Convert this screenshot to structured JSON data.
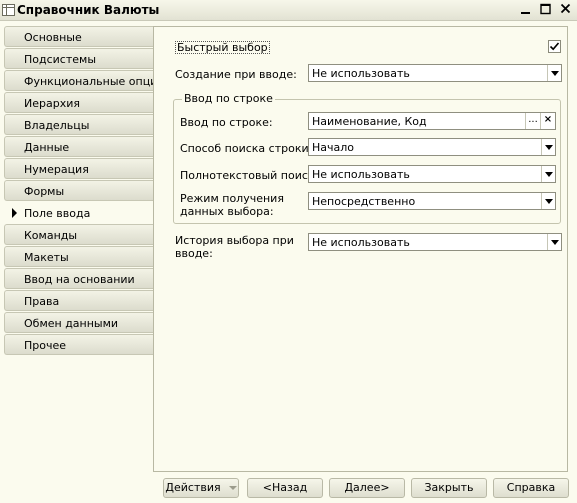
{
  "window": {
    "title": "Справочник Валюты",
    "icon": "table-icon"
  },
  "nav": {
    "items": [
      {
        "label": "Основные"
      },
      {
        "label": "Подсистемы"
      },
      {
        "label": "Функциональные опции"
      },
      {
        "label": "Иерархия"
      },
      {
        "label": "Владельцы"
      },
      {
        "label": "Данные"
      },
      {
        "label": "Нумерация"
      },
      {
        "label": "Формы"
      },
      {
        "label": "Поле ввода"
      },
      {
        "label": "Команды"
      },
      {
        "label": "Макеты"
      },
      {
        "label": "Ввод на основании"
      },
      {
        "label": "Права"
      },
      {
        "label": "Обмен данными"
      },
      {
        "label": "Прочее"
      }
    ],
    "active_index": 8
  },
  "form": {
    "quick_select": {
      "label": "Быстрый выбор",
      "checked": true
    },
    "create_on_input": {
      "label": "Создание при вводе:",
      "value": "Не использовать"
    },
    "input_by_string_group": {
      "caption": "Ввод по строке"
    },
    "input_by_string": {
      "label": "Ввод по строке:",
      "value": "Наименование, Код",
      "select_glyph": "...",
      "clear_glyph": "×"
    },
    "search_mode": {
      "label": "Способ поиска строки:",
      "value": "Начало"
    },
    "fulltext_search": {
      "label": "Полнотекстовый поиск:",
      "value": "Не использовать"
    },
    "choice_data_mode": {
      "label_line1": "Режим получения",
      "label_line2": "данных выбора:",
      "value": "Непосредственно"
    },
    "choice_history": {
      "label_line1": "История выбора при",
      "label_line2": "вводе:",
      "value": "Не использовать"
    }
  },
  "footer": {
    "actions": "Действия",
    "back": "<Назад",
    "next": "Далее>",
    "close": "Закрыть",
    "help": "Справка"
  }
}
